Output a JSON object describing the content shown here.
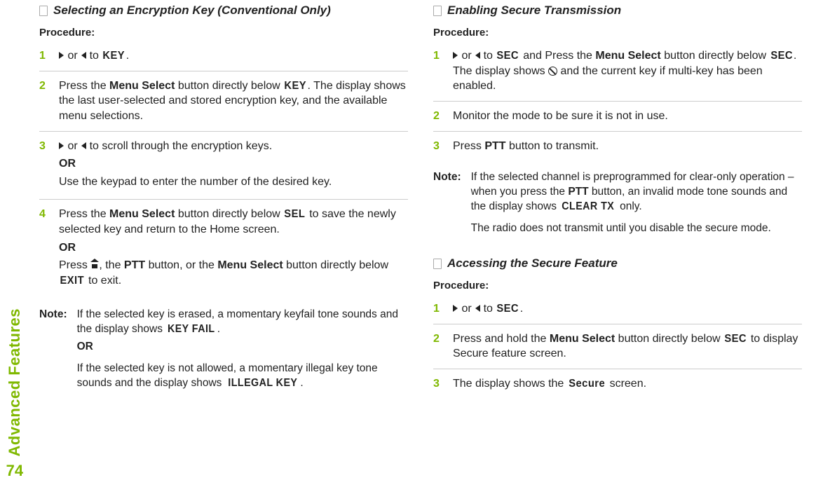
{
  "sideTab": "Advanced Features",
  "pageNumber": "74",
  "left": {
    "title": "Selecting an Encryption Key (Conventional Only)",
    "procLabel": "Procedure:",
    "steps": {
      "s1": {
        "num": "1",
        "to": " to ",
        "key": "KEY",
        "end": "."
      },
      "s2": {
        "num": "2",
        "a": "Press the ",
        "b": "Menu Select",
        "c": " button directly below ",
        "d": "KEY",
        "e": ". The display shows the last user-selected and stored encryption key, and the available menu selections."
      },
      "s3": {
        "num": "3",
        "a": " to scroll through the encryption keys.",
        "or": "OR",
        "b": "Use the keypad to enter the number of the desired key."
      },
      "s4": {
        "num": "4",
        "a": "Press the ",
        "b": "Menu Select",
        "c": " button directly below ",
        "d": "SEL",
        "e": " to save the newly selected key and return to the Home screen.",
        "or": "OR",
        "f": "Press ",
        "g": ", the ",
        "h": "PTT",
        "i": " button, or the ",
        "j": "Menu Select",
        "k": " button directly below ",
        "l": "EXIT",
        "m": " to exit."
      }
    },
    "note": {
      "label": "Note:",
      "a": "If the selected key is erased, a momentary keyfail tone sounds and the display shows ",
      "b": "KEY FAIL",
      "c": ".",
      "or": "OR",
      "d": "If the selected key is not allowed, a momentary illegal key tone sounds and the display shows ",
      "e": "ILLEGAL KEY",
      "f": "."
    }
  },
  "right": {
    "sec1": {
      "title": "Enabling Secure Transmission",
      "procLabel": "Procedure:",
      "steps": {
        "s1": {
          "num": "1",
          "to": " to ",
          "sec": "SEC",
          "a": " and Press the ",
          "b": "Menu Select",
          "c": " button directly below ",
          "d": "SEC",
          "e": ". The display shows ",
          "f": " and the current key if multi-key has been enabled."
        },
        "s2": {
          "num": "2",
          "a": "Monitor the mode to be sure it is not in use."
        },
        "s3": {
          "num": "3",
          "a": "Press ",
          "b": "PTT",
          "c": " button to transmit."
        }
      },
      "note": {
        "label": "Note:",
        "a": "If the selected channel is preprogrammed for clear-only operation – when you press the ",
        "b": "PTT",
        "c": " button, an invalid mode tone sounds and the display shows ",
        "d": "CLEAR TX",
        "e": " only.",
        "f": "The radio does not transmit until you disable the secure mode."
      }
    },
    "sec2": {
      "title": "Accessing the Secure Feature",
      "procLabel": "Procedure:",
      "steps": {
        "s1": {
          "num": "1",
          "to": " to ",
          "sec": "SEC",
          "end": "."
        },
        "s2": {
          "num": "2",
          "a": "Press and hold the ",
          "b": "Menu Select",
          "c": " button directly below ",
          "d": "SEC",
          "e": " to display Secure feature screen."
        },
        "s3": {
          "num": "3",
          "a": "The display shows the ",
          "b": "Secure",
          "c": " screen."
        }
      }
    }
  },
  "orWord": " or "
}
